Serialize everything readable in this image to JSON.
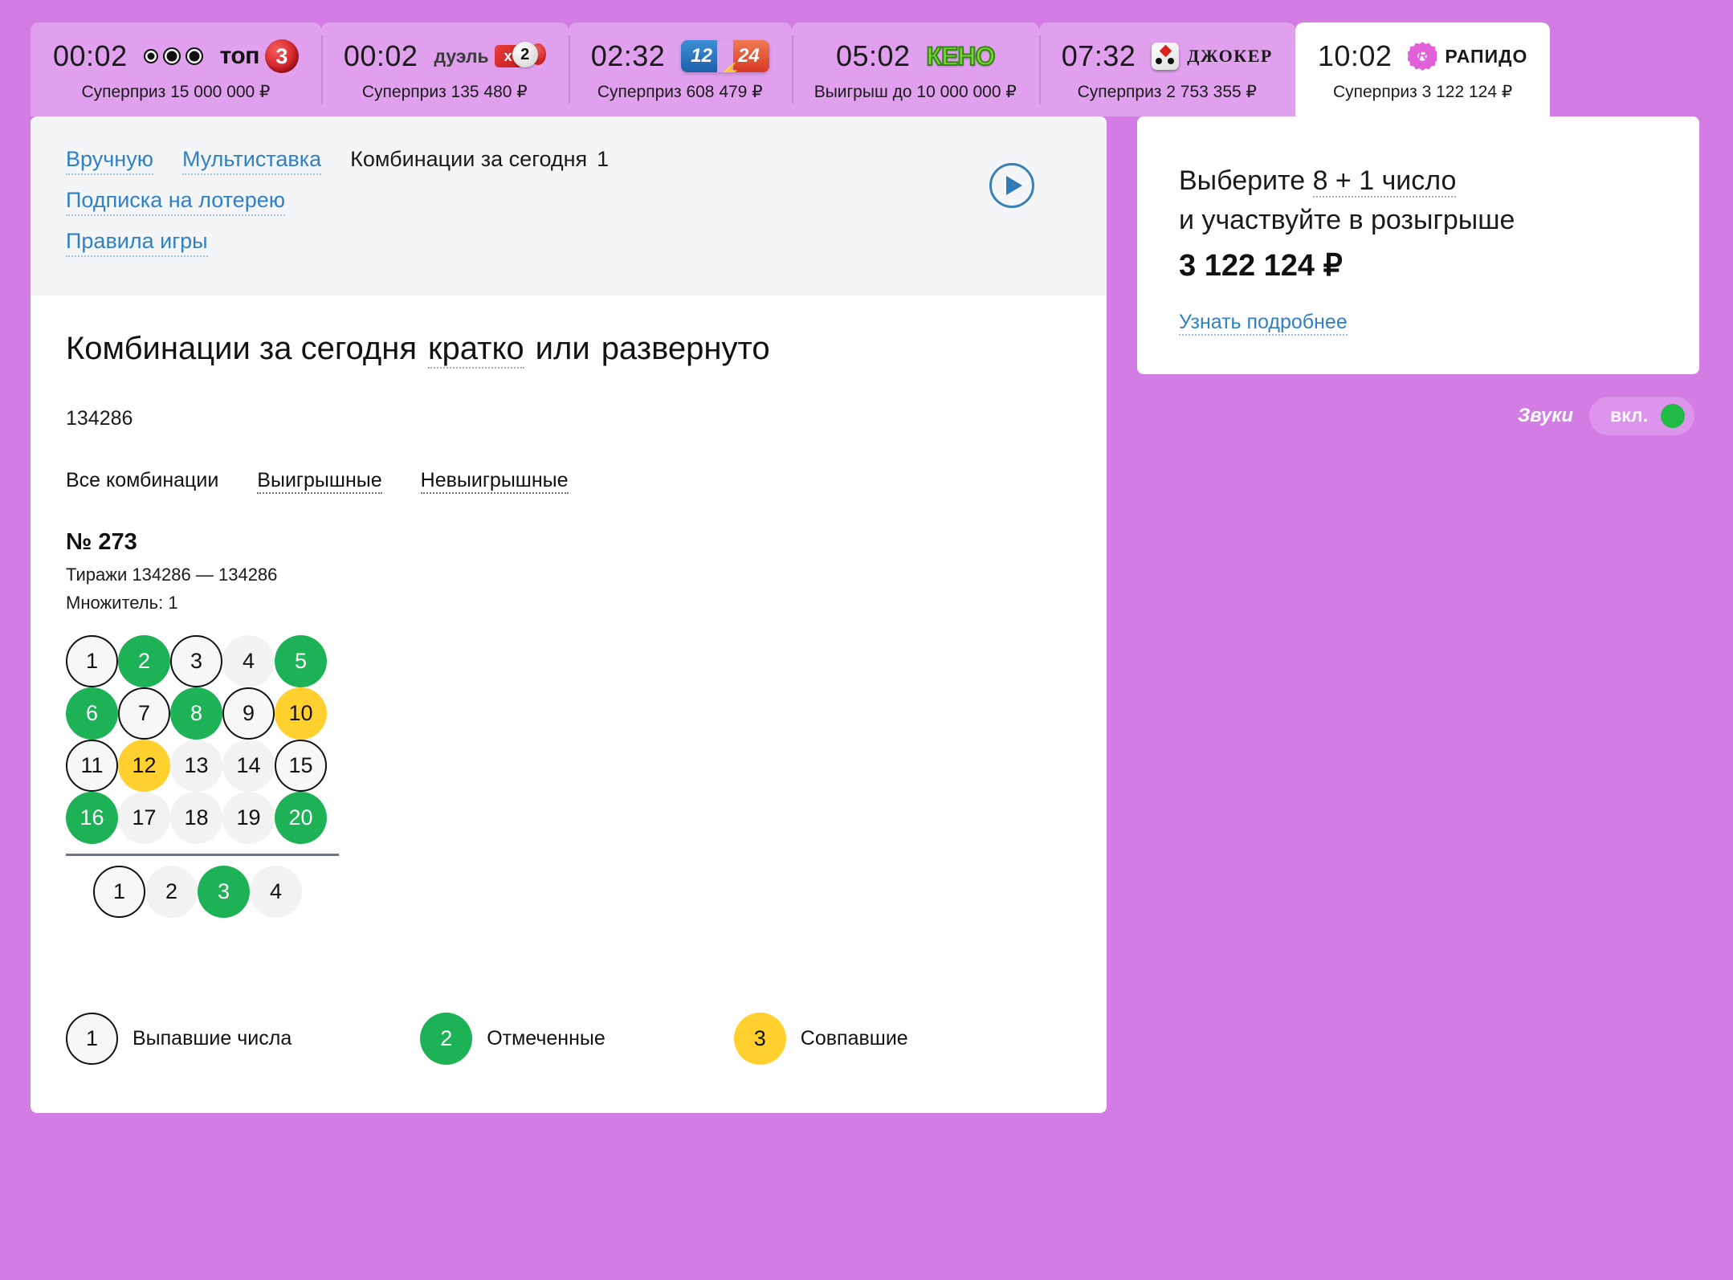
{
  "top_bar": {
    "lotteries": [
      {
        "time": "00:02",
        "prize": "Суперприз 15 000 000 ₽",
        "name": "ТОП 3",
        "logo": "top3-logo",
        "active": false
      },
      {
        "time": "00:02",
        "prize": "Суперприз 135 480 ₽",
        "name": "дуэль",
        "logo": "duel-logo",
        "active": false
      },
      {
        "time": "02:32",
        "prize": "Суперприз 608 479 ₽",
        "name": "12/24",
        "logo": "twelve24-logo",
        "active": false
      },
      {
        "time": "05:02",
        "prize": "Выигрыш до 10 000 000 ₽",
        "name": "КЕНО",
        "logo": "keno-logo",
        "active": false
      },
      {
        "time": "07:32",
        "prize": "Суперприз 2 753 355 ₽",
        "name": "ДЖОКЕР",
        "logo": "joker-logo",
        "active": false
      },
      {
        "time": "10:02",
        "prize": "Суперприз 3 122 124 ₽",
        "name": "РАПИДО",
        "logo": "rapido-logo",
        "active": true
      }
    ],
    "labels": {
      "top3_word": "топ",
      "top3_ball": "3",
      "duel_word": "дуэль",
      "duel_x": "x",
      "duel_num": "2",
      "l12": "12",
      "l24": "24",
      "keno_word": "КЕНО",
      "joker_word": "ДЖОКЕР",
      "rapido_word": "РАПИДО"
    }
  },
  "nav": {
    "manual": "Вручную",
    "multibet": "Мультиставка",
    "today_combos": "Комбинации за сегодня",
    "today_combos_count": "1",
    "subscription": "Подписка на лотерею",
    "rules": "Правила игры",
    "play_icon": "play-icon"
  },
  "main": {
    "title_prefix": "Комбинации за сегодня",
    "title_short": "кратко",
    "title_or": "или",
    "title_full": "развернуто",
    "draw_id": "134286",
    "filters": [
      {
        "label": "Все комбинации",
        "active": true
      },
      {
        "label": "Выигрышные",
        "active": false
      },
      {
        "label": "Невыигрышные",
        "active": false
      }
    ],
    "combo": {
      "number": "№ 273",
      "draws": "Тиражи 134286 — 134286",
      "multiplier": "Множитель: 1",
      "main_balls": [
        {
          "n": "1",
          "state": "outline"
        },
        {
          "n": "2",
          "state": "green"
        },
        {
          "n": "3",
          "state": "outline"
        },
        {
          "n": "4",
          "state": "plain"
        },
        {
          "n": "5",
          "state": "green"
        },
        {
          "n": "6",
          "state": "green"
        },
        {
          "n": "7",
          "state": "outline"
        },
        {
          "n": "8",
          "state": "green"
        },
        {
          "n": "9",
          "state": "outline"
        },
        {
          "n": "10",
          "state": "yellow"
        },
        {
          "n": "11",
          "state": "outline"
        },
        {
          "n": "12",
          "state": "yellow"
        },
        {
          "n": "13",
          "state": "plain"
        },
        {
          "n": "14",
          "state": "plain"
        },
        {
          "n": "15",
          "state": "outline"
        },
        {
          "n": "16",
          "state": "green"
        },
        {
          "n": "17",
          "state": "plain"
        },
        {
          "n": "18",
          "state": "plain"
        },
        {
          "n": "19",
          "state": "plain"
        },
        {
          "n": "20",
          "state": "green"
        }
      ],
      "bonus_balls": [
        {
          "n": "1",
          "state": "outline"
        },
        {
          "n": "2",
          "state": "plain"
        },
        {
          "n": "3",
          "state": "green"
        },
        {
          "n": "4",
          "state": "plain"
        }
      ]
    },
    "legend": [
      {
        "n": "1",
        "state": "outline",
        "label": "Выпавшие числа"
      },
      {
        "n": "2",
        "state": "green",
        "label": "Отмеченные"
      },
      {
        "n": "3",
        "state": "yellow",
        "label": "Совпавшие"
      }
    ]
  },
  "sidebar": {
    "promo_line1_a": "Выберите",
    "promo_line1_b": "8 + 1 число",
    "promo_line2": "и участвуйте в розыгрыше",
    "promo_amount": "3 122 124 ₽",
    "promo_link": "Узнать подробнее",
    "sound_label": "Звуки",
    "sound_state": "вкл."
  },
  "colors": {
    "page_bg": "#d27ce4",
    "tab_bg": "#e0a0ee",
    "tab_active_bg": "#ffffff",
    "link_blue": "#2f80c4",
    "ball_green": "#1eb257",
    "ball_yellow": "#ffd02e",
    "toggle_green": "#1fbb44"
  }
}
